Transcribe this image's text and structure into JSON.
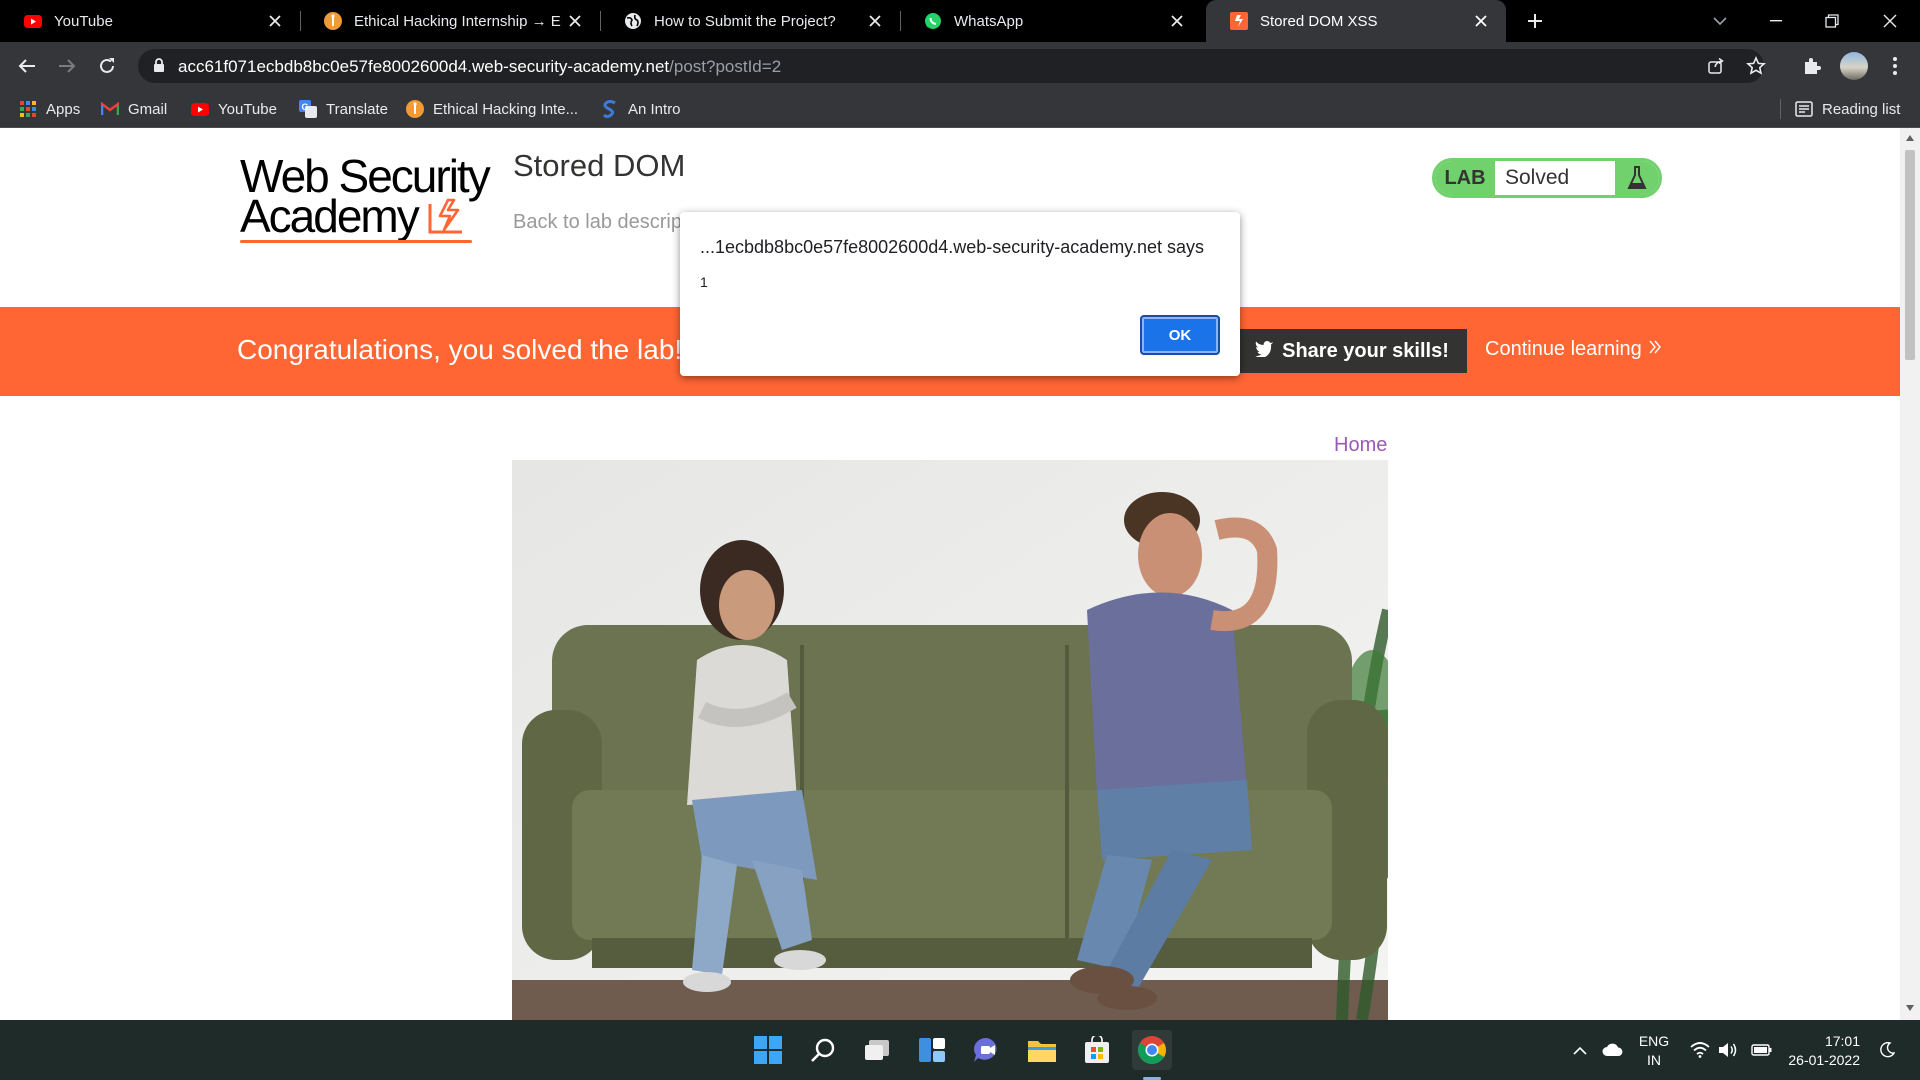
{
  "browser": {
    "tabs": [
      {
        "title": "YouTube",
        "icon": "youtube-icon",
        "active": false
      },
      {
        "title": "Ethical Hacking Internship → EH I",
        "icon": "internship-icon",
        "active": false
      },
      {
        "title": "How to Submit the Project?",
        "icon": "globe-icon",
        "active": false
      },
      {
        "title": "WhatsApp",
        "icon": "whatsapp-icon",
        "active": false
      },
      {
        "title": "Stored DOM XSS",
        "icon": "portswigger-icon",
        "active": true
      }
    ],
    "url_host": "acc61f071ecbdb8bc0e57fe8002600d4.web-security-academy.net",
    "url_path": "/post?postId=2",
    "bookmarks": [
      {
        "label": "Apps",
        "icon": "apps-grid-icon"
      },
      {
        "label": "Gmail",
        "icon": "gmail-icon"
      },
      {
        "label": "YouTube",
        "icon": "youtube-icon"
      },
      {
        "label": "Translate",
        "icon": "translate-icon"
      },
      {
        "label": "Ethical Hacking Inte...",
        "icon": "internship-icon"
      },
      {
        "label": "An Intro",
        "icon": "s-icon"
      }
    ],
    "reading_list": "Reading list"
  },
  "page": {
    "logo_line1": "Web Security",
    "logo_line2": "Academy",
    "lab_title": "Stored DOM",
    "back_link": "Back to lab descrip",
    "lab_badge": "LAB",
    "lab_status": "Solved",
    "banner": {
      "message": "Congratulations, you solved the lab!",
      "share": "Share your skills!",
      "continue": "Continue learning"
    },
    "home": "Home"
  },
  "dialog": {
    "title": "...1ecbdb8bc0e57fe8002600d4.web-security-academy.net says",
    "message": "1",
    "ok": "OK"
  },
  "taskbar": {
    "lang_line1": "ENG",
    "lang_line2": "IN",
    "time": "17:01",
    "date": "26-01-2022"
  },
  "colors": {
    "brand_orange": "#ff6633",
    "lab_green": "#70d16d",
    "link_purple": "#9b59b6",
    "dialog_button": "#1a73e8"
  }
}
